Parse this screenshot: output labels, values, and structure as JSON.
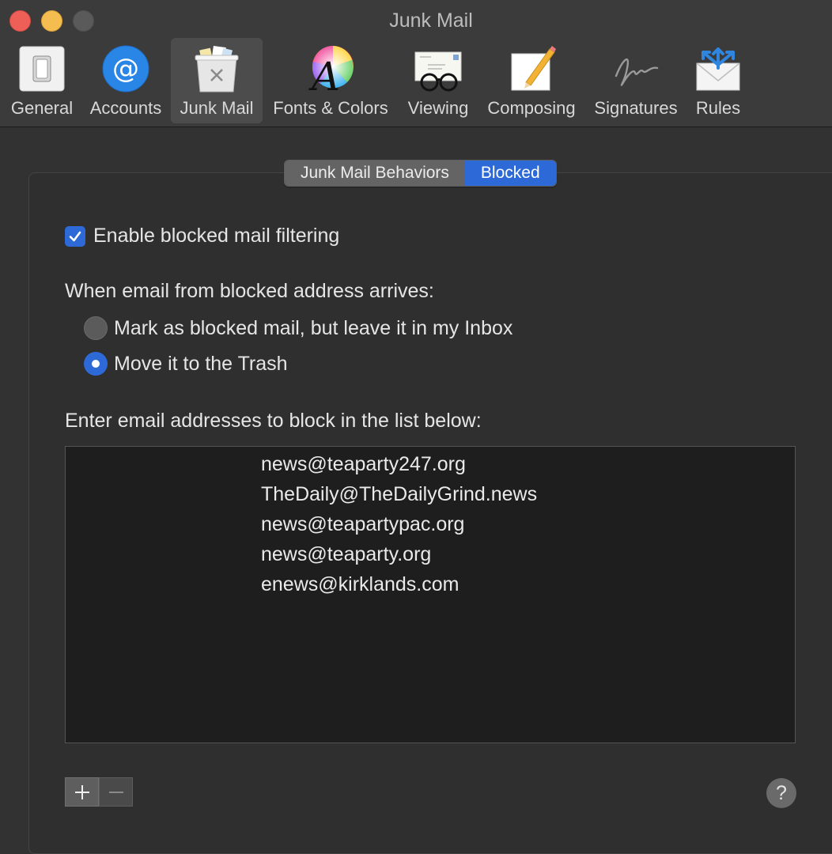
{
  "window": {
    "title": "Junk Mail"
  },
  "toolbar": {
    "items": [
      {
        "label": "General",
        "icon": "general-switch-icon"
      },
      {
        "label": "Accounts",
        "icon": "at-sign-icon"
      },
      {
        "label": "Junk Mail",
        "icon": "junk-mail-bin-icon",
        "selected": true
      },
      {
        "label": "Fonts & Colors",
        "icon": "fonts-colors-icon"
      },
      {
        "label": "Viewing",
        "icon": "viewing-glasses-icon"
      },
      {
        "label": "Composing",
        "icon": "composing-pencil-icon"
      },
      {
        "label": "Signatures",
        "icon": "signature-icon"
      },
      {
        "label": "Rules",
        "icon": "rules-envelope-icon"
      }
    ]
  },
  "tabs": {
    "behaviors": "Junk Mail Behaviors",
    "blocked": "Blocked",
    "selected": "Blocked"
  },
  "blocked": {
    "enable_label": "Enable blocked mail filtering",
    "enable_checked": true,
    "when_label": "When email from blocked address arrives:",
    "options": [
      {
        "label": "Mark as blocked mail, but leave it in my Inbox",
        "selected": false
      },
      {
        "label": "Move it to the Trash",
        "selected": true
      }
    ],
    "list_label": "Enter email addresses to block in the list below:",
    "addresses": [
      "news@teaparty247.org",
      "TheDaily@TheDailyGrind.news",
      "news@teapartypac.org",
      "news@teaparty.org",
      "enews@kirklands.com"
    ]
  },
  "controls": {
    "add_symbol": "+",
    "remove_symbol": "−",
    "help_symbol": "?"
  },
  "colors": {
    "accent": "#2d6ad8",
    "close": "#ee5f57",
    "minimize": "#f5bd4f"
  }
}
